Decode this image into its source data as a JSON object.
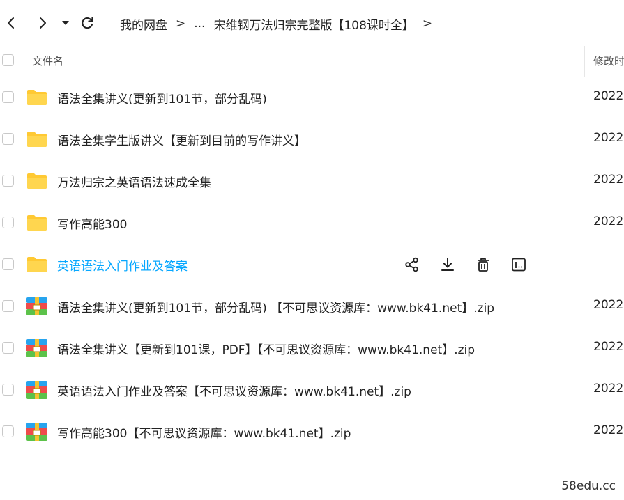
{
  "breadcrumb": {
    "items": [
      "我的网盘",
      "...",
      "宋维钢万法归宗完整版【108课时全】"
    ],
    "separator": ">"
  },
  "header": {
    "name_col": "文件名",
    "date_col": "修改时"
  },
  "files": [
    {
      "name": "语法全集讲义(更新到101节，部分乱码)",
      "type": "folder",
      "date": "2022"
    },
    {
      "name": "语法全集学生版讲义【更新到目前的写作讲义】",
      "type": "folder",
      "date": "2022"
    },
    {
      "name": "万法归宗之英语语法速成全集",
      "type": "folder",
      "date": "2022"
    },
    {
      "name": "写作高能300",
      "type": "folder",
      "date": "2022"
    },
    {
      "name": "英语语法入门作业及答案",
      "type": "folder",
      "date": ""
    },
    {
      "name": "语法全集讲义(更新到101节，部分乱码) 【不可思议资源库：www.bk41.net】.zip",
      "type": "zip",
      "date": "2022"
    },
    {
      "name": "语法全集讲义【更新到101课，PDF】【不可思议资源库：www.bk41.net】.zip",
      "type": "zip",
      "date": "2022"
    },
    {
      "name": "英语语法入门作业及答案【不可思议资源库：www.bk41.net】.zip",
      "type": "zip",
      "date": "2022"
    },
    {
      "name": "写作高能300【不可思议资源库：www.bk41.net】.zip",
      "type": "zip",
      "date": "2022"
    }
  ],
  "hover_actions": [
    "share-icon",
    "download-icon",
    "delete-icon",
    "more-icon"
  ],
  "watermark": "58edu.cc",
  "colors": {
    "accent": "#06a7ff",
    "folder": "#ffc933",
    "text": "#222222"
  }
}
